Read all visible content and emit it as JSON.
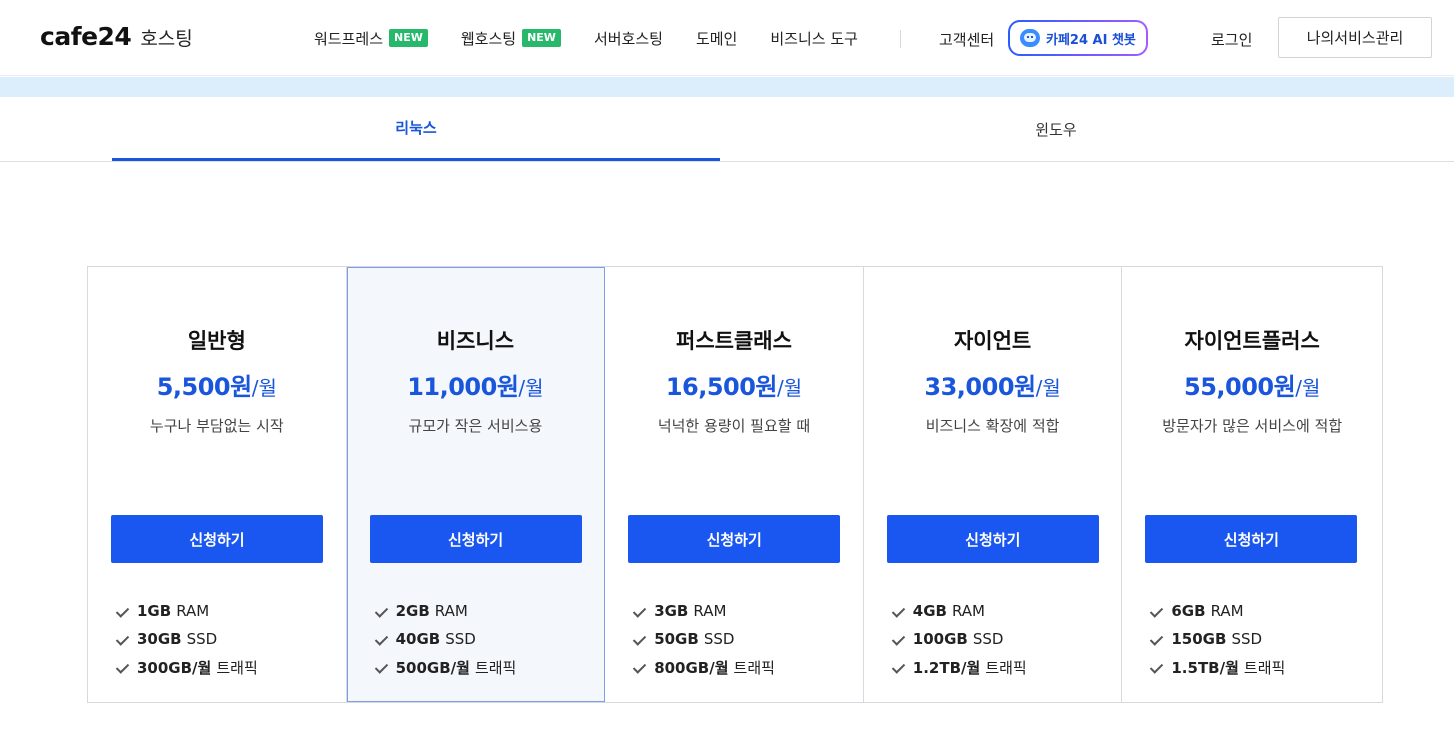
{
  "header": {
    "logo_brand": "cafe24",
    "logo_sub": "호스팅",
    "nav": [
      {
        "label": "워드프레스",
        "badge": "NEW"
      },
      {
        "label": "웹호스팅",
        "badge": "NEW"
      },
      {
        "label": "서버호스팅"
      },
      {
        "label": "도메인"
      },
      {
        "label": "비즈니스 도구"
      }
    ],
    "support": "고객센터",
    "chatbot": "카페24 AI 챗봇",
    "login": "로그인",
    "my_service": "나의서비스관리"
  },
  "tabs": [
    {
      "label": "리눅스",
      "active": true
    },
    {
      "label": "윈도우",
      "active": false
    }
  ],
  "apply_label": "신청하기",
  "plans": [
    {
      "name": "일반형",
      "price": "5,500원",
      "per": "/월",
      "desc": "누구나 부담없는 시작",
      "features": [
        {
          "strong": "1GB",
          "rest": "RAM"
        },
        {
          "strong": "30GB",
          "rest": "SSD"
        },
        {
          "strong": "300GB/월",
          "rest": "트래픽"
        }
      ]
    },
    {
      "name": "비즈니스",
      "price": "11,000원",
      "per": "/월",
      "desc": "규모가 작은 서비스용",
      "features": [
        {
          "strong": "2GB",
          "rest": "RAM"
        },
        {
          "strong": "40GB",
          "rest": "SSD"
        },
        {
          "strong": "500GB/월",
          "rest": "트래픽"
        }
      ]
    },
    {
      "name": "퍼스트클래스",
      "price": "16,500원",
      "per": "/월",
      "desc": "넉넉한 용량이 필요할 때",
      "features": [
        {
          "strong": "3GB",
          "rest": "RAM"
        },
        {
          "strong": "50GB",
          "rest": "SSD"
        },
        {
          "strong": "800GB/월",
          "rest": "트래픽"
        }
      ]
    },
    {
      "name": "자이언트",
      "price": "33,000원",
      "per": "/월",
      "desc": "비즈니스 확장에 적합",
      "features": [
        {
          "strong": "4GB",
          "rest": "RAM"
        },
        {
          "strong": "100GB",
          "rest": "SSD"
        },
        {
          "strong": "1.2TB/월",
          "rest": "트래픽"
        }
      ]
    },
    {
      "name": "자이언트플러스",
      "price": "55,000원",
      "per": "/월",
      "desc": "방문자가 많은 서비스에 적합",
      "features": [
        {
          "strong": "6GB",
          "rest": "RAM"
        },
        {
          "strong": "150GB",
          "rest": "SSD"
        },
        {
          "strong": "1.5TB/월",
          "rest": "트래픽"
        }
      ]
    }
  ],
  "colors": {
    "accent": "#1a56db",
    "button": "#1a56f0",
    "badge": "#28b86c",
    "strip": "#dcedfb",
    "highlight_bg": "#f4f8fd"
  }
}
